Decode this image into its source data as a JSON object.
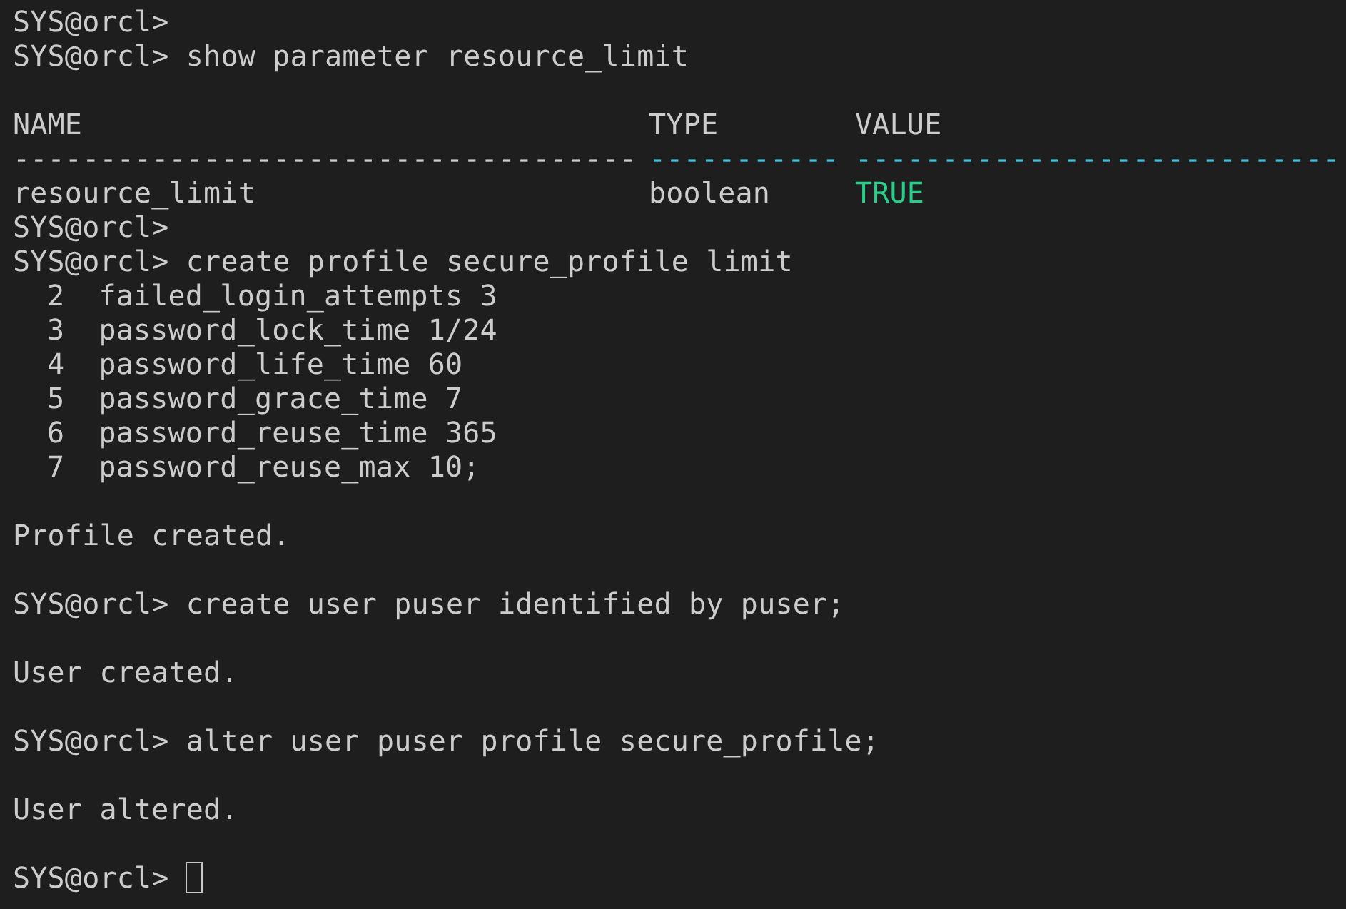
{
  "terminal": {
    "lines": [
      {
        "kind": "prompt",
        "prompt": "SYS@orcl>"
      },
      {
        "kind": "prompt",
        "prompt": "SYS@orcl>",
        "command": "show parameter resource_limit"
      },
      {
        "kind": "blank"
      },
      {
        "kind": "table_header",
        "cells": [
          {
            "text": "NAME"
          },
          {
            "text": "TYPE"
          },
          {
            "text": "VALUE"
          }
        ]
      },
      {
        "kind": "separator",
        "cells": [
          {
            "text": "------------------------------------",
            "color": "#cccccc"
          },
          {
            "text": "-----------",
            "color": "#3ac4e0"
          },
          {
            "text": "----------------------------",
            "color": "#3ac4e0"
          }
        ]
      },
      {
        "kind": "table_row",
        "cells": [
          {
            "text": "resource_limit",
            "color": "#cccccc"
          },
          {
            "text": "boolean",
            "color": "#cccccc"
          },
          {
            "text": "TRUE",
            "color": "#23d18b"
          }
        ]
      },
      {
        "kind": "prompt",
        "prompt": "SYS@orcl>"
      },
      {
        "kind": "prompt",
        "prompt": "SYS@orcl>",
        "command": "create profile secure_profile limit"
      },
      {
        "kind": "continuation",
        "number": "2",
        "text": "failed_login_attempts 3"
      },
      {
        "kind": "continuation",
        "number": "3",
        "text": "password_lock_time 1/24"
      },
      {
        "kind": "continuation",
        "number": "4",
        "text": "password_life_time 60"
      },
      {
        "kind": "continuation",
        "number": "5",
        "text": "password_grace_time 7"
      },
      {
        "kind": "continuation",
        "number": "6",
        "text": "password_reuse_time 365"
      },
      {
        "kind": "continuation",
        "number": "7",
        "text": "password_reuse_max 10;"
      },
      {
        "kind": "blank"
      },
      {
        "kind": "output",
        "text": "Profile created."
      },
      {
        "kind": "blank"
      },
      {
        "kind": "prompt",
        "prompt": "SYS@orcl>",
        "command": "create user puser identified by puser;"
      },
      {
        "kind": "blank"
      },
      {
        "kind": "output",
        "text": "User created."
      },
      {
        "kind": "blank"
      },
      {
        "kind": "prompt",
        "prompt": "SYS@orcl>",
        "command": "alter user puser profile secure_profile;"
      },
      {
        "kind": "blank"
      },
      {
        "kind": "output",
        "text": "User altered."
      },
      {
        "kind": "blank"
      },
      {
        "kind": "prompt",
        "prompt": "SYS@orcl>",
        "cursor": true
      }
    ]
  }
}
